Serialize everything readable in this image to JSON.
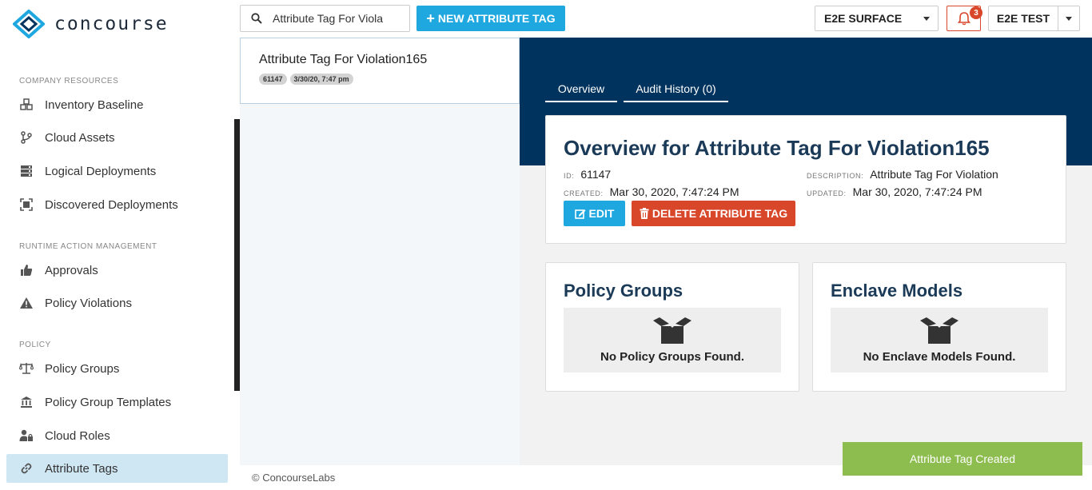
{
  "app": {
    "logo_text": "concourse",
    "footer": "© ConcourseLabs"
  },
  "sidebar": {
    "sections": [
      {
        "label": "COMPANY RESOURCES"
      },
      {
        "label": "RUNTIME ACTION MANAGEMENT"
      },
      {
        "label": "POLICY"
      }
    ],
    "items": [
      {
        "label": "Inventory Baseline",
        "icon": "cubes-icon"
      },
      {
        "label": "Cloud Assets",
        "icon": "branch-icon"
      },
      {
        "label": "Logical Deployments",
        "icon": "server-icon"
      },
      {
        "label": "Discovered Deployments",
        "icon": "scan-icon"
      },
      {
        "label": "Approvals",
        "icon": "thumbs-up-icon"
      },
      {
        "label": "Policy Violations",
        "icon": "warning-icon"
      },
      {
        "label": "Policy Groups",
        "icon": "scale-icon"
      },
      {
        "label": "Policy Group Templates",
        "icon": "bank-icon"
      },
      {
        "label": "Cloud Roles",
        "icon": "user-lock-icon"
      },
      {
        "label": "Attribute Tags",
        "icon": "link-icon",
        "active": true
      }
    ]
  },
  "topbar": {
    "search_value": "Attribute Tag For Viola",
    "new_button": "NEW ATTRIBUTE TAG",
    "environment": "E2E SURFACE",
    "notification_count": "3",
    "user": "E2E TEST"
  },
  "list": {
    "items": [
      {
        "title": "Attribute Tag For Violation165",
        "id_badge": "61147",
        "date_badge": "3/30/20, 7:47 pm"
      }
    ]
  },
  "detail": {
    "tabs": [
      {
        "label": "Overview"
      },
      {
        "label": "Audit History (0)"
      }
    ],
    "title": "Overview for Attribute Tag For Violation165",
    "id_label": "ID:",
    "id_value": "61147",
    "created_label": "CREATED:",
    "created_value": "Mar 30, 2020, 7:47:24 PM",
    "description_label": "DESCRIPTION:",
    "description_value": "Attribute Tag For Violation",
    "updated_label": "UPDATED:",
    "updated_value": "Mar 30, 2020, 7:47:24 PM",
    "edit_button": "EDIT",
    "delete_button": "DELETE ATTRIBUTE TAG",
    "policy_groups": {
      "title": "Policy Groups",
      "empty": "No Policy Groups Found."
    },
    "enclave_models": {
      "title": "Enclave Models",
      "empty": "No Enclave Models Found."
    }
  },
  "toast": "Attribute Tag Created",
  "colors": {
    "primary": "#1fa8e0",
    "danger": "#d9472b",
    "navy": "#00335e",
    "success": "#8dbc4f",
    "active_nav": "#cfe7f3"
  }
}
